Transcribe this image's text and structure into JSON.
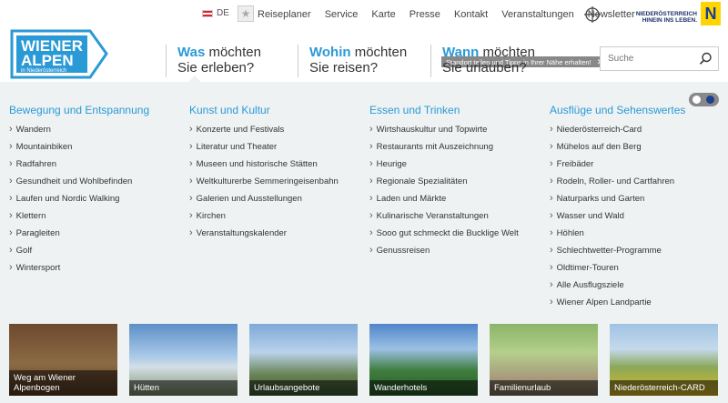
{
  "topbar": {
    "lang": "DE",
    "nav": [
      "Reiseplaner",
      "Service",
      "Karte",
      "Presse",
      "Kontakt",
      "Veranstaltungen",
      "Newsletter"
    ],
    "noe_logo": "NIEDERÖSTERREICH HINEIN INS LEBEN.",
    "noe_badge": "N"
  },
  "logo": {
    "line1": "WIENER",
    "line2": "ALPEN",
    "line3": "in Niederösterreich"
  },
  "tooltip": {
    "text": "Standort teilen und Tipps in Ihrer Nähe erhalten!",
    "close": "✕"
  },
  "questions": [
    {
      "kw": "Was",
      "rest": " möchten",
      "line2": "Sie erleben?"
    },
    {
      "kw": "Wohin",
      "rest": " möchten",
      "line2": "Sie reisen?"
    },
    {
      "kw": "Wann",
      "rest": " möchten",
      "line2": "Sie urlauben?"
    }
  ],
  "search": {
    "placeholder": "Suche"
  },
  "menu": {
    "col1": {
      "title": "Bewegung und Entspannung",
      "items": [
        "Wandern",
        "Mountainbiken",
        "Radfahren",
        "Gesundheit und Wohlbefinden",
        "Laufen und Nordic Walking",
        "Klettern",
        "Paragleiten",
        "Golf",
        "Wintersport"
      ]
    },
    "col2": {
      "title": "Kunst und Kultur",
      "items": [
        "Konzerte und Festivals",
        "Literatur und Theater",
        "Museen und historische Stätten",
        "Weltkulturerbe Semmeringeisenbahn",
        "Galerien und Ausstellungen",
        "Kirchen",
        "Veranstaltungskalender"
      ]
    },
    "col3": {
      "title": "Essen und Trinken",
      "items": [
        "Wirtshauskultur und Topwirte",
        "Restaurants mit Auszeichnung",
        "Heurige",
        "Regionale Spezialitäten",
        "Laden und Märkte",
        "Kulinarische Veranstaltungen",
        "Sooo gut schmeckt die Bucklige Welt",
        "Genussreisen"
      ]
    },
    "col4": {
      "title": "Ausflüge und Sehenswertes",
      "items": [
        "Niederösterreich-Card",
        "Mühelos auf den Berg",
        "Freibäder",
        "Rodeln, Roller- und Cartfahren",
        "Naturparks und Garten",
        "Wasser und Wald",
        "Höhlen",
        "Schlechtwetter-Programme",
        "Oldtimer-Touren",
        "Alle Ausflugsziele",
        "Wiener Alpen Landpartie"
      ]
    }
  },
  "tiles": [
    "Weg am Wiener Alpenbogen",
    "Hütten",
    "Urlaubsangebote",
    "Wanderhotels",
    "Familienurlaub",
    "Niederösterreich-CARD"
  ],
  "colors": {
    "accent": "#2a9ad6",
    "menu_bg": "#eef2f3",
    "brand_navy": "#1c3f8f"
  }
}
